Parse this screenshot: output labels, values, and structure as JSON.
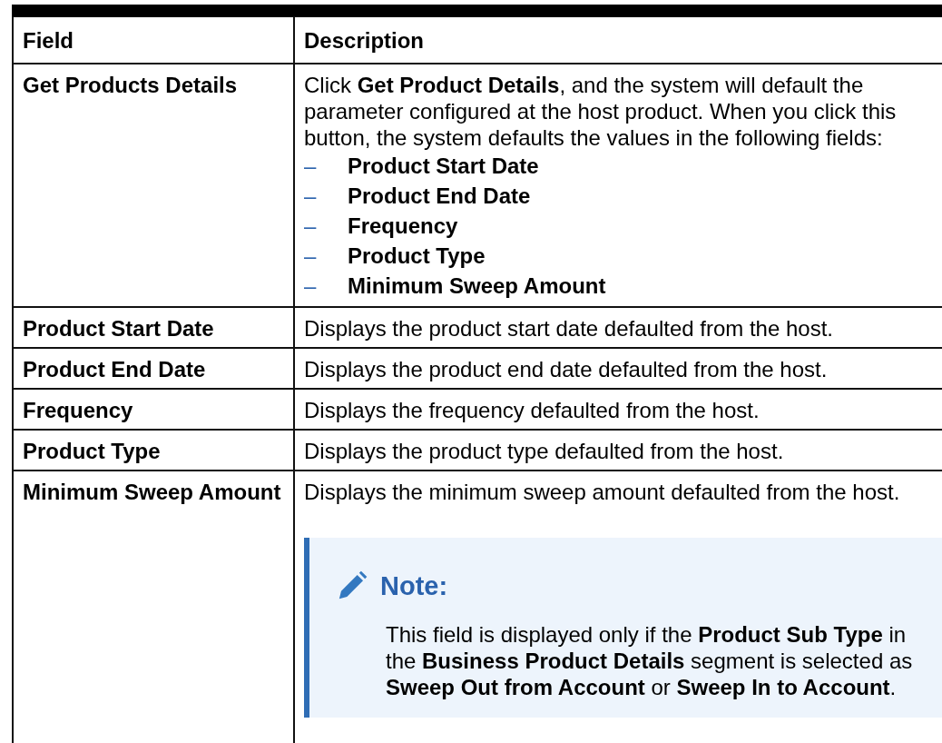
{
  "table": {
    "columns": [
      "Field",
      "Description"
    ],
    "rows": [
      {
        "field": "Get Products Details",
        "description": "Click **Get Product Details**, and the system will default the parameter configured at the host product. When you click this button, the system defaults the values in the following fields:",
        "list": [
          {
            "marker": "–",
            "text": "Product Start Date"
          },
          {
            "marker": "–",
            "text": "Product End Date"
          },
          {
            "marker": "–",
            "text": "Frequency"
          },
          {
            "marker": "–",
            "text": "Product Type"
          },
          {
            "marker": "–",
            "text": "Minimum Sweep Amount"
          }
        ]
      },
      {
        "field": "Product Start Date",
        "description": "Displays the product start date defaulted from the host."
      },
      {
        "field": "Product End Date",
        "description": "Displays the product end date defaulted from the host."
      },
      {
        "field": "Frequency",
        "description": "Displays the frequency defaulted from the host."
      },
      {
        "field": "Product Type",
        "description": "Displays the product type defaulted from the host."
      },
      {
        "field": "Minimum Sweep Amount",
        "description": "Displays the minimum sweep amount defaulted from the host.",
        "note": {
          "title": "Note:",
          "text": "This field is displayed only if the **Product Sub Type** in the **Business Product Details** segment is selected as **Sweep Out from Account** or **Sweep In to Account**."
        }
      }
    ]
  }
}
